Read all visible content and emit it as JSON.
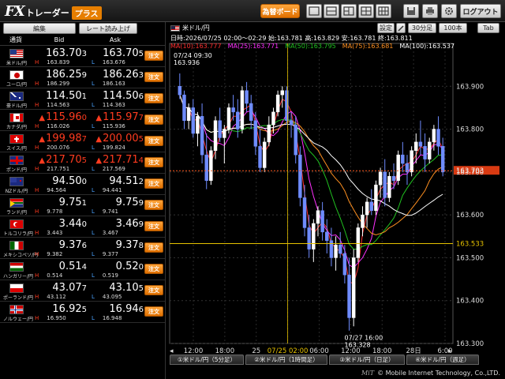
{
  "header": {
    "logo_fx": "FX",
    "logo_trader": "トレーダー",
    "logo_plus": "プラス",
    "order_board": "為替ボード",
    "logout": "ログアウト",
    "layout_icons": [
      "layout-single-icon",
      "layout-split-icon",
      "layout-grid-icon",
      "layout-quad-icon",
      "layout-six-icon"
    ],
    "tool_icons": [
      "save-icon",
      "print-icon",
      "gear-icon",
      "help-icon"
    ]
  },
  "rate_panel": {
    "edit_button": "編集",
    "rate_readout_button": "レート読み上げ",
    "col_pair": "通貨",
    "col_bid": "Bid",
    "col_ask": "Ask",
    "order_label": "注文",
    "high_marker": "H",
    "low_marker": "L",
    "rows": [
      {
        "pair": "米ドル/円",
        "flag": "us",
        "bid_main": "163.70",
        "bid_last": "3",
        "ask_main": "163.70",
        "ask_last": "5",
        "high": "163.839",
        "low": "163.676",
        "up": false
      },
      {
        "pair": "ユーロ/円",
        "flag": "eu",
        "bid_main": "186.25",
        "bid_last": "9",
        "ask_main": "186.26",
        "ask_last": "3",
        "high": "186.299",
        "low": "186.163",
        "up": false
      },
      {
        "pair": "豪ドル/円",
        "flag": "au",
        "bid_main": "114.50",
        "bid_last": "1",
        "ask_main": "114.50",
        "ask_last": "6",
        "high": "114.563",
        "low": "114.363",
        "up": false
      },
      {
        "pair": "カナダ/円",
        "flag": "ca",
        "bid_main": "115.96",
        "bid_last": "0",
        "ask_main": "115.97",
        "ask_last": "7",
        "high": "116.026",
        "low": "115.936",
        "up": true
      },
      {
        "pair": "スイス/円",
        "flag": "ch",
        "bid_main": "199.98",
        "bid_last": "7",
        "ask_main": "200.00",
        "ask_last": "5",
        "high": "200.076",
        "low": "199.824",
        "up": true
      },
      {
        "pair": "ポンド/円",
        "flag": "gb",
        "bid_main": "217.70",
        "bid_last": "5",
        "ask_main": "217.71",
        "ask_last": "4",
        "high": "217.751",
        "low": "217.569",
        "up": true
      },
      {
        "pair": "NZドル/円",
        "flag": "nz",
        "bid_main": "94.50",
        "bid_last": "0",
        "ask_main": "94.51",
        "ask_last": "2",
        "high": "94.564",
        "low": "94.441",
        "up": false
      },
      {
        "pair": "ランド/円",
        "flag": "za",
        "bid_main": "9.75",
        "bid_last": "1",
        "ask_main": "9.75",
        "ask_last": "9",
        "high": "9.778",
        "low": "9.741",
        "up": false
      },
      {
        "pair": "トルコリラ/円",
        "flag": "tr",
        "bid_main": "3.44",
        "bid_last": "0",
        "ask_main": "3.46",
        "ask_last": "9",
        "high": "3.443",
        "low": "3.467",
        "up": false
      },
      {
        "pair": "メキシコペソ/円",
        "flag": "mx",
        "bid_main": "9.37",
        "bid_last": "6",
        "ask_main": "9.37",
        "ask_last": "8",
        "high": "9.382",
        "low": "9.377",
        "up": false
      },
      {
        "pair": "ハンガリー/円",
        "flag": "hu",
        "bid_main": "0.51",
        "bid_last": "4",
        "ask_main": "0.52",
        "ask_last": "0",
        "high": "0.514",
        "low": "0.519",
        "up": false
      },
      {
        "pair": "ポーランド/円",
        "flag": "pl",
        "bid_main": "43.07",
        "bid_last": "7",
        "ask_main": "43.10",
        "ask_last": "5",
        "high": "43.112",
        "low": "43.095",
        "up": false
      },
      {
        "pair": "ノルウェー/円",
        "flag": "no",
        "bid_main": "16.92",
        "bid_last": "5",
        "ask_main": "16.94",
        "ask_last": "6",
        "high": "16.950",
        "low": "16.948",
        "up": false
      }
    ]
  },
  "chart_panel": {
    "title": "米ドル/円",
    "settings_button": "設定",
    "timeframe_button": "30分足",
    "count_button": "100本",
    "tab_button": "Tab",
    "tabs": [
      "①米ドル/円（5分足）",
      "②米ドル/円（1時間足）",
      "③米ドル/円（日足）",
      "④米ドル/円（週足）"
    ],
    "footer_logo": "MiT",
    "footer_text": "© Mobile Internet Technology, Co.,LTD."
  },
  "chart_data": {
    "type": "candlestick",
    "info_line1": "日時:2026/07/25 02:00～02:29 始:163.781 高:163.829 安:163.781 終:163.811",
    "ma_labels": [
      {
        "text": "MA(10):163.777",
        "color": "#ff3030"
      },
      {
        "text": "MA(25):163.771",
        "color": "#ff30ff"
      },
      {
        "text": "MA(50):163.795",
        "color": "#20c020"
      },
      {
        "text": "MA(75):163.681",
        "color": "#ff9020"
      },
      {
        "text": "MA(100):163.537",
        "color": "#ffffff"
      }
    ],
    "ylim": [
      163.3,
      164.0
    ],
    "y_ticks": [
      163.3,
      163.4,
      163.5,
      163.6,
      163.7,
      163.8,
      163.9
    ],
    "y_tick_labels": [
      "163.300",
      "163.400",
      "163.500",
      "163.600",
      "163.700",
      "163.800",
      "163.900"
    ],
    "x_tick_labels": [
      "12:00",
      "18:00",
      "25",
      "07/25 02:00",
      "06:00",
      "12:00",
      "18:00",
      "28日",
      "6:00"
    ],
    "current_price": 163.703,
    "current_price_label": "163.703",
    "hline_price": 163.533,
    "hline_label": "163.533",
    "annotation_high": {
      "date": "07/24 09:30",
      "value": "163.936"
    },
    "annotation_low": {
      "date": "07/27 16:00",
      "value": "163.328"
    },
    "candles": [
      [
        163.9,
        163.93,
        163.87,
        163.88
      ],
      [
        163.88,
        163.89,
        163.8,
        163.82
      ],
      [
        163.82,
        163.86,
        163.8,
        163.85
      ],
      [
        163.85,
        163.87,
        163.78,
        163.79
      ],
      [
        163.79,
        163.84,
        163.76,
        163.83
      ],
      [
        163.83,
        163.86,
        163.72,
        163.74
      ],
      [
        163.74,
        163.79,
        163.66,
        163.68
      ],
      [
        163.68,
        163.76,
        163.67,
        163.75
      ],
      [
        163.75,
        163.83,
        163.73,
        163.82
      ],
      [
        163.82,
        163.85,
        163.77,
        163.78
      ],
      [
        163.78,
        163.81,
        163.72,
        163.8
      ],
      [
        163.8,
        163.86,
        163.79,
        163.85
      ],
      [
        163.85,
        163.88,
        163.82,
        163.84
      ],
      [
        163.84,
        163.87,
        163.78,
        163.8
      ],
      [
        163.8,
        163.9,
        163.79,
        163.89
      ],
      [
        163.89,
        163.91,
        163.84,
        163.86
      ],
      [
        163.86,
        163.88,
        163.8,
        163.82
      ],
      [
        163.82,
        163.84,
        163.74,
        163.76
      ],
      [
        163.76,
        163.8,
        163.7,
        163.71
      ],
      [
        163.71,
        163.78,
        163.7,
        163.77
      ],
      [
        163.77,
        163.83,
        163.76,
        163.81
      ],
      [
        163.81,
        163.85,
        163.79,
        163.84
      ],
      [
        163.84,
        163.89,
        163.83,
        163.88
      ],
      [
        163.88,
        163.9,
        163.85,
        163.89
      ],
      [
        163.89,
        163.9,
        163.81,
        163.82
      ],
      [
        163.82,
        163.84,
        163.78,
        163.81
      ],
      [
        163.81,
        163.83,
        163.72,
        163.74
      ],
      [
        163.74,
        163.76,
        163.62,
        163.64
      ],
      [
        163.64,
        163.67,
        163.55,
        163.57
      ],
      [
        163.57,
        163.6,
        163.5,
        163.52
      ],
      [
        163.52,
        163.59,
        163.49,
        163.58
      ],
      [
        163.58,
        163.62,
        163.55,
        163.61
      ],
      [
        163.61,
        163.63,
        163.54,
        163.56
      ],
      [
        163.56,
        163.59,
        163.51,
        163.54
      ],
      [
        163.54,
        163.57,
        163.48,
        163.5
      ],
      [
        163.5,
        163.55,
        163.47,
        163.53
      ],
      [
        163.53,
        163.56,
        163.5,
        163.51
      ],
      [
        163.51,
        163.53,
        163.44,
        163.46
      ],
      [
        163.46,
        163.5,
        163.33,
        163.36
      ],
      [
        163.36,
        163.52,
        163.34,
        163.5
      ],
      [
        163.5,
        163.58,
        163.49,
        163.57
      ],
      [
        163.57,
        163.62,
        163.55,
        163.6
      ],
      [
        163.6,
        163.64,
        163.57,
        163.63
      ],
      [
        163.63,
        163.66,
        163.6,
        163.61
      ],
      [
        163.61,
        163.68,
        163.6,
        163.67
      ],
      [
        163.67,
        163.71,
        163.64,
        163.7
      ],
      [
        163.7,
        163.73,
        163.62,
        163.64
      ],
      [
        163.64,
        163.7,
        163.63,
        163.69
      ],
      [
        163.69,
        163.72,
        163.66,
        163.68
      ],
      [
        163.68,
        163.75,
        163.67,
        163.74
      ],
      [
        163.74,
        163.77,
        163.7,
        163.72
      ],
      [
        163.72,
        163.74,
        163.67,
        163.7
      ],
      [
        163.7,
        163.76,
        163.69,
        163.75
      ],
      [
        163.75,
        163.79,
        163.72,
        163.77
      ],
      [
        163.77,
        163.82,
        163.74,
        163.76
      ],
      [
        163.76,
        163.79,
        163.7,
        163.73
      ],
      [
        163.73,
        163.78,
        163.72,
        163.77
      ],
      [
        163.77,
        163.81,
        163.75,
        163.8
      ],
      [
        163.8,
        163.83,
        163.74,
        163.76
      ],
      [
        163.76,
        163.78,
        163.69,
        163.7
      ]
    ]
  }
}
